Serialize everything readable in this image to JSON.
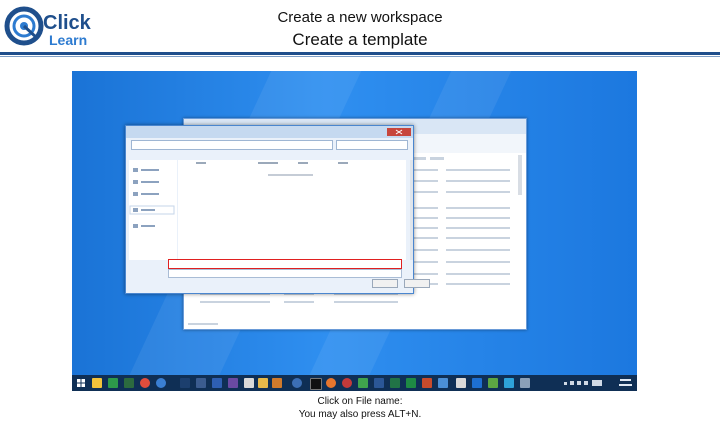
{
  "header": {
    "logo_top": "Click",
    "logo_bottom": "Learn",
    "title": "Create a new workspace",
    "subtitle": "Create a template"
  },
  "caption": {
    "line1": "Click on File name:",
    "line2": "You may also press ALT+N."
  },
  "colors": {
    "brand_blue": "#1f4f8c",
    "desktop_blue": "#1f7fe6",
    "highlight_red": "#e02020"
  },
  "taskbar": {
    "icons": [
      "windows-start",
      "file-explorer",
      "excel",
      "project",
      "chrome",
      "internet-explorer",
      "powerpoint",
      "firefox",
      "visual-studio",
      "paint",
      "tool",
      "click-learn",
      "cmd",
      "firefox2",
      "chrome2",
      "media",
      "word",
      "excel2",
      "app",
      "app2",
      "app3",
      "app4"
    ]
  }
}
